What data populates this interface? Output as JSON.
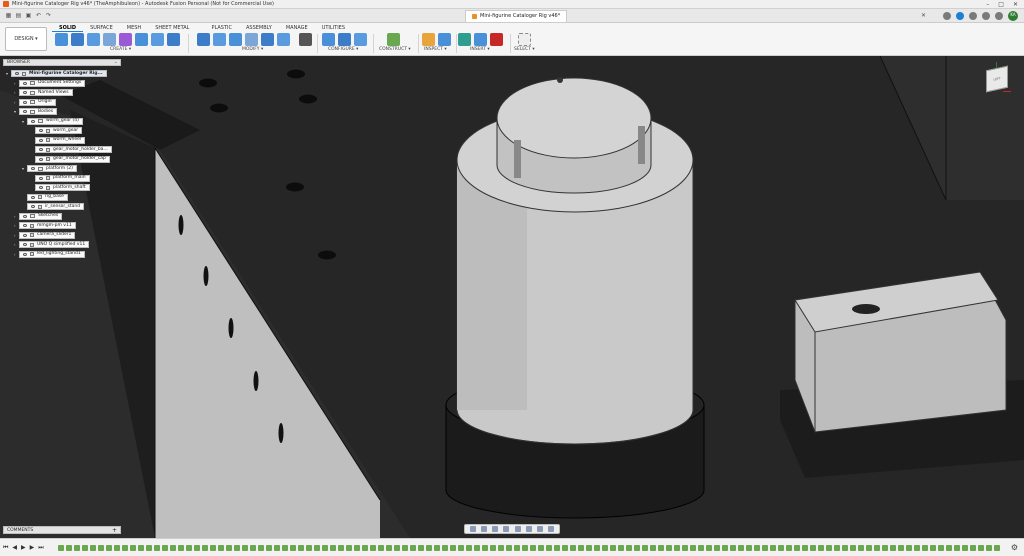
{
  "window": {
    "title": "Mini-figurine Cataloger Rig v46* (TheAmphibuleon) - Autodesk Fusion Personal (Not for Commercial Use)",
    "controls": [
      "–",
      "□",
      "✕"
    ]
  },
  "document_tab": {
    "label": "Mini-figurine Cataloger Rig v46*",
    "close": "✕"
  },
  "user": {
    "initials": "KA"
  },
  "workspace": {
    "label": "DESIGN ▾"
  },
  "ribbon": {
    "tabs": [
      "SOLID",
      "SURFACE",
      "MESH",
      "SHEET METAL",
      "PLASTIC",
      "ASSEMBLY",
      "MANAGE",
      "UTILITIES"
    ],
    "active_tab": "SOLID",
    "groups": [
      "CREATE ▾",
      "MODIFY ▾",
      "CONFIGURE ▾",
      "CONSTRUCT ▾",
      "INSPECT ▾",
      "INSERT ▾",
      "SELECT ▾"
    ]
  },
  "browser": {
    "header": "BROWSER",
    "min_icon": "–",
    "items": [
      {
        "label": "Mini-figurine Cataloger Rig...",
        "level": 0,
        "kind": "root",
        "arrow": "▾"
      },
      {
        "label": "Document Settings",
        "level": 1,
        "kind": "gear",
        "arrow": "›"
      },
      {
        "label": "Named Views",
        "level": 1,
        "kind": "folder",
        "arrow": "›"
      },
      {
        "label": "Origin",
        "level": 1,
        "kind": "folder",
        "arrow": "›"
      },
      {
        "label": "Bodies",
        "level": 1,
        "kind": "folder",
        "arrow": "▾"
      },
      {
        "label": "worm_gear (4)",
        "level": 2,
        "kind": "folder",
        "arrow": "▾"
      },
      {
        "label": "worm_gear",
        "level": 3,
        "kind": "body",
        "arrow": ""
      },
      {
        "label": "worm_wheel",
        "level": 3,
        "kind": "body",
        "arrow": ""
      },
      {
        "label": "gear_motor_holder_ba...",
        "level": 3,
        "kind": "body",
        "arrow": ""
      },
      {
        "label": "gear_motor_holder_cap",
        "level": 3,
        "kind": "body",
        "arrow": ""
      },
      {
        "label": "platform (2)",
        "level": 2,
        "kind": "folder",
        "arrow": "▾"
      },
      {
        "label": "platform_main",
        "level": 3,
        "kind": "body",
        "arrow": ""
      },
      {
        "label": "platform_shaft",
        "level": 3,
        "kind": "body",
        "arrow": ""
      },
      {
        "label": "rig_base",
        "level": 2,
        "kind": "body",
        "arrow": ""
      },
      {
        "label": "ir_sensor_stand",
        "level": 2,
        "kind": "body",
        "arrow": ""
      },
      {
        "label": "Sketches",
        "level": 1,
        "kind": "folder",
        "arrow": "›"
      },
      {
        "label": "mmgm-pm v11",
        "level": 1,
        "kind": "link",
        "arrow": "›"
      },
      {
        "label": "camera_slider1",
        "level": 1,
        "kind": "link",
        "arrow": "›"
      },
      {
        "label": "UNO Q simplified v11",
        "level": 1,
        "kind": "link",
        "arrow": "›"
      },
      {
        "label": "led_lighting_stand1",
        "level": 1,
        "kind": "link",
        "arrow": "›"
      }
    ]
  },
  "viewcube": {
    "face": "LEFT"
  },
  "comments": {
    "label": "COMMENTS",
    "plus": "+"
  },
  "timeline": {
    "controls": [
      "⏮",
      "◀",
      "▶",
      "▶",
      "⏭"
    ],
    "settings": "⚙"
  },
  "colors": {
    "accent": "#1c7ed6",
    "viewport_bg": "#2b2b2b"
  }
}
